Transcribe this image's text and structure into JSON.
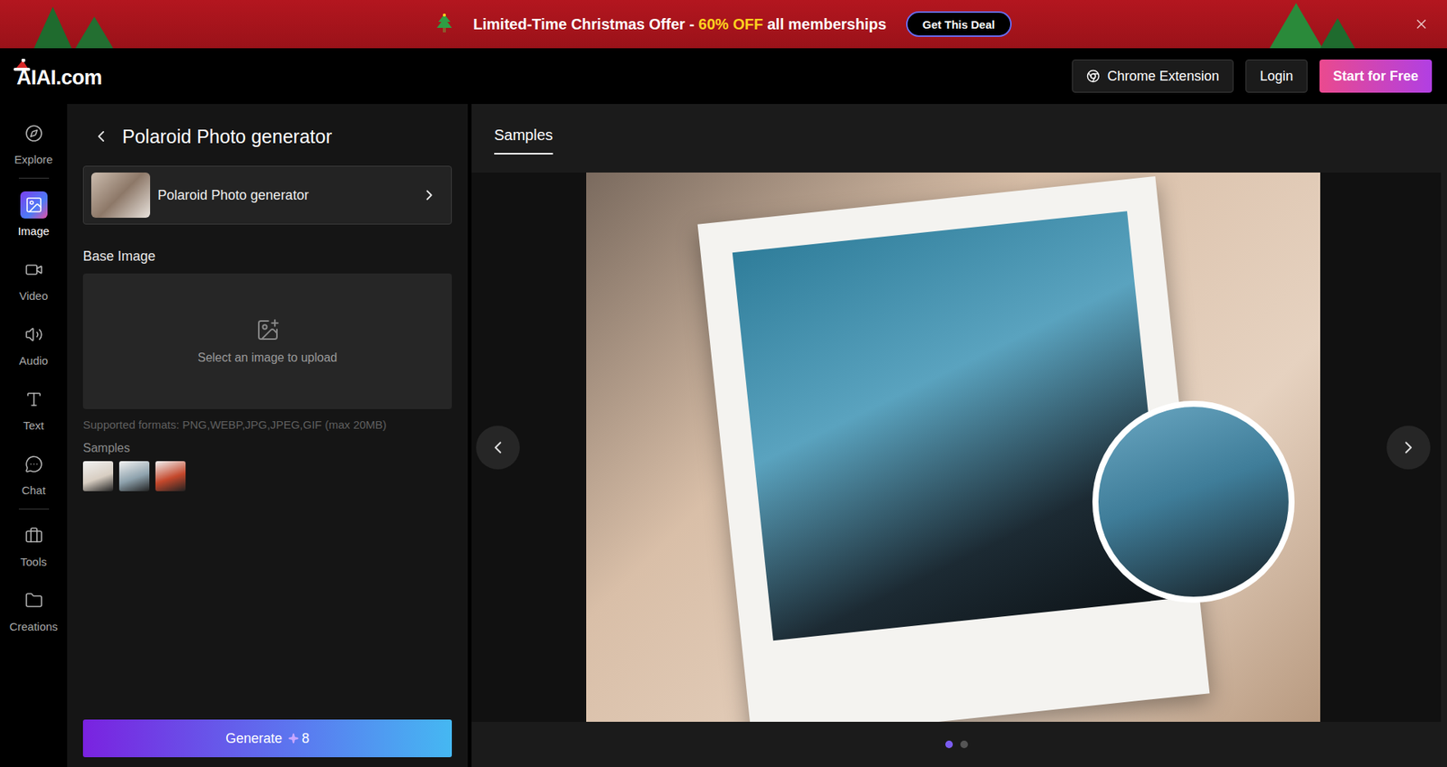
{
  "banner": {
    "text": "Limited-Time Christmas Offer - ",
    "highlight": "60% OFF",
    "text_end": " all memberships",
    "button": "Get This Deal"
  },
  "header": {
    "logo": "AIAI.com",
    "buttons": [
      {
        "label": "Chrome Extension",
        "kind": "outline"
      },
      {
        "label": "Login",
        "kind": "outline"
      },
      {
        "label": "Start for Free",
        "kind": "primary"
      }
    ]
  },
  "nav": {
    "items": [
      {
        "label": "Explore",
        "selected": false
      },
      {
        "label": "Image",
        "selected": true
      },
      {
        "label": "Video",
        "selected": false
      },
      {
        "label": "Audio",
        "selected": false
      },
      {
        "label": "Text",
        "selected": false
      },
      {
        "label": "Chat",
        "selected": false
      },
      {
        "label": "Tools",
        "selected": false
      },
      {
        "label": "Creations",
        "selected": false
      }
    ]
  },
  "panel": {
    "title": "Polaroid Photo generator",
    "model": "Polaroid Photo generator",
    "base_image_label": "Base Image",
    "upload_text": "Select an image to upload",
    "formats": "Supported formats: PNG,WEBP,JPG,JPEG,GIF (max 20MB)",
    "samples_label": "Samples",
    "samples": [
      {
        "color": "#d8cec2"
      },
      {
        "color": "#8ea2ad"
      },
      {
        "color": "#c4482c"
      }
    ],
    "generate": {
      "label": "Generate",
      "cost": "8"
    }
  },
  "viewer": {
    "tabs": [
      {
        "label": "Samples",
        "selected": true
      }
    ],
    "slides": [
      {
        "selected": true
      },
      {
        "selected": false
      }
    ]
  }
}
